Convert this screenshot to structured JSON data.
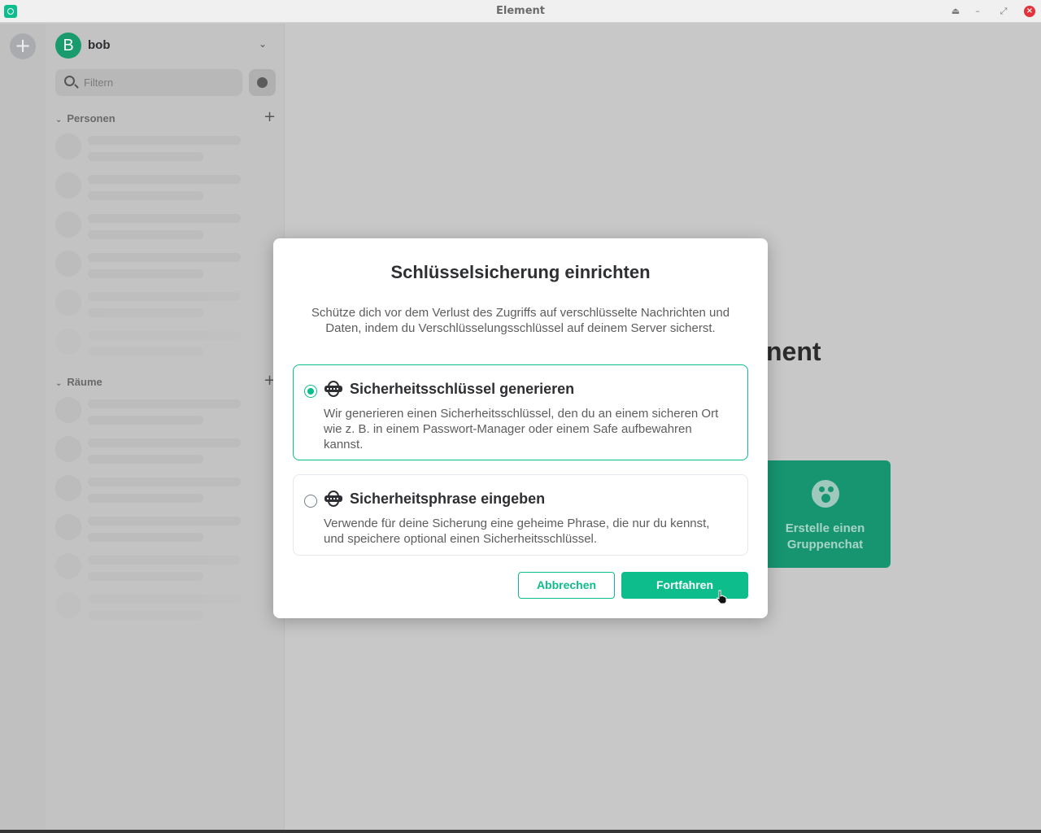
{
  "window": {
    "title": "Element",
    "controls": {
      "eject": "⏏",
      "minimize": "–",
      "maximize": "⤢",
      "close": "×"
    }
  },
  "spaces": {
    "add_label": "+"
  },
  "user": {
    "avatar_letter": "B",
    "name": "bob",
    "menu_chevron": "⌄"
  },
  "filter": {
    "placeholder": "Filtern"
  },
  "sections": {
    "people": {
      "label": "Personen",
      "add": "+"
    },
    "rooms": {
      "label": "Räume",
      "add": "+"
    }
  },
  "home": {
    "heading_fragment": "nent",
    "card_label": "Erstelle einen Gruppenchat"
  },
  "dialog": {
    "title": "Schlüsselsicherung einrichten",
    "description": "Schütze dich vor dem Verlust des Zugriffs auf verschlüsselte Nachrichten und Daten, indem du Verschlüsselungsschlüssel auf deinem Server sicherst.",
    "options": [
      {
        "title": "Sicherheitsschlüssel generieren",
        "description": "Wir generieren einen Sicherheitsschlüssel, den du an einem sicheren Ort wie z. B. in einem Passwort-Manager oder einem Safe aufbewahren kannst.",
        "selected": true
      },
      {
        "title": "Sicherheitsphrase eingeben",
        "description": "Verwende für deine Sicherung eine geheime Phrase, die nur du kennst, und speichere optional einen Sicherheitsschlüssel.",
        "selected": false
      }
    ],
    "cancel_label": "Abbrechen",
    "continue_label": "Fortfahren"
  },
  "colors": {
    "accent": "#0dbd8b",
    "overlay_background": "#c8c8c8",
    "dialog_background": "#ffffff",
    "close_button": "#e4323c"
  }
}
